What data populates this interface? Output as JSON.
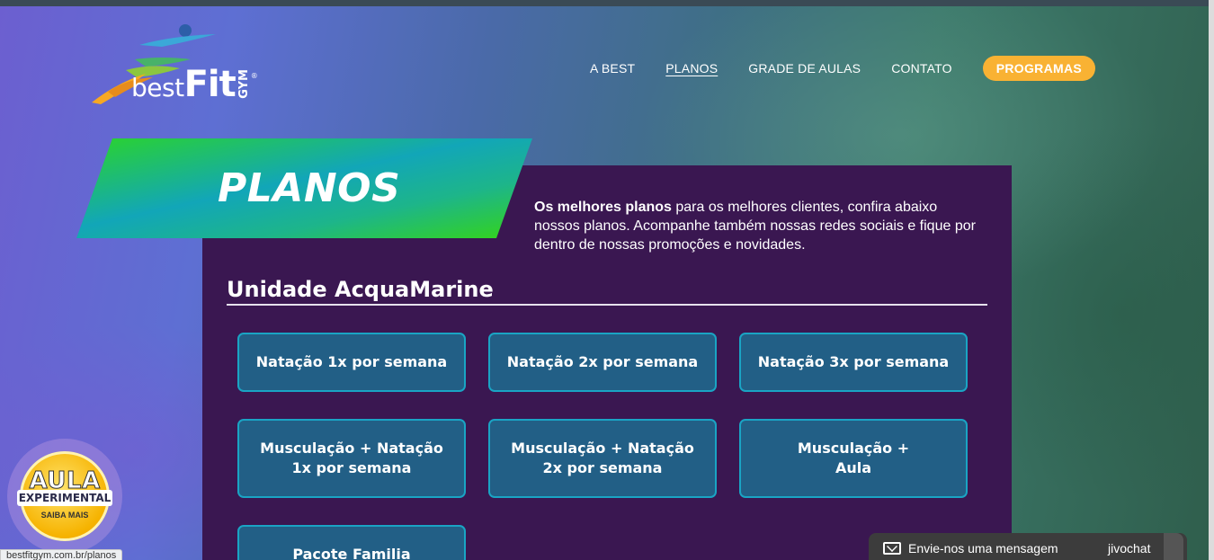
{
  "logo": {
    "best": "best",
    "fit": "Fit",
    "gym": "GYM",
    "reg": "®"
  },
  "nav": {
    "items": [
      "A BEST",
      "PLANOS",
      "GRADE DE AULAS",
      "CONTATO"
    ],
    "cta": "PROGRAMAS"
  },
  "hero": {
    "title": "PLANOS",
    "intro_bold": "Os melhores planos",
    "intro_rest": " para os melhores clientes, confira abaixo nossos planos. Acompanhe também nossas redes sociais e fique por dentro de nossas promoções e novidades."
  },
  "section": {
    "title": "Unidade AcquaMarine"
  },
  "plans": [
    {
      "line1": "Natação 1x por semana",
      "line2": ""
    },
    {
      "line1": "Natação 2x por semana",
      "line2": ""
    },
    {
      "line1": "Natação 3x por semana",
      "line2": ""
    },
    {
      "line1": "Musculação + Natação",
      "line2": "1x por semana"
    },
    {
      "line1": "Musculação + Natação",
      "line2": "2x por semana"
    },
    {
      "line1": "Musculação +",
      "line2": "Aula"
    },
    {
      "line1": "Pacote Familia",
      "line2": ""
    }
  ],
  "badge": {
    "aula": "AULA",
    "experimental": "EXPERIMENTAL",
    "saiba": "SAIBA MAIS"
  },
  "status_url": "bestfitgym.com.br/planos",
  "chat": {
    "label": "Envie-nos uma mensagem",
    "brand": "jivochat"
  },
  "colors": {
    "accent": "#f9b233",
    "panel": "#3a1751",
    "button": "#225f86",
    "button_border": "#1aa4c4",
    "banner_green": "#2ed11a"
  }
}
